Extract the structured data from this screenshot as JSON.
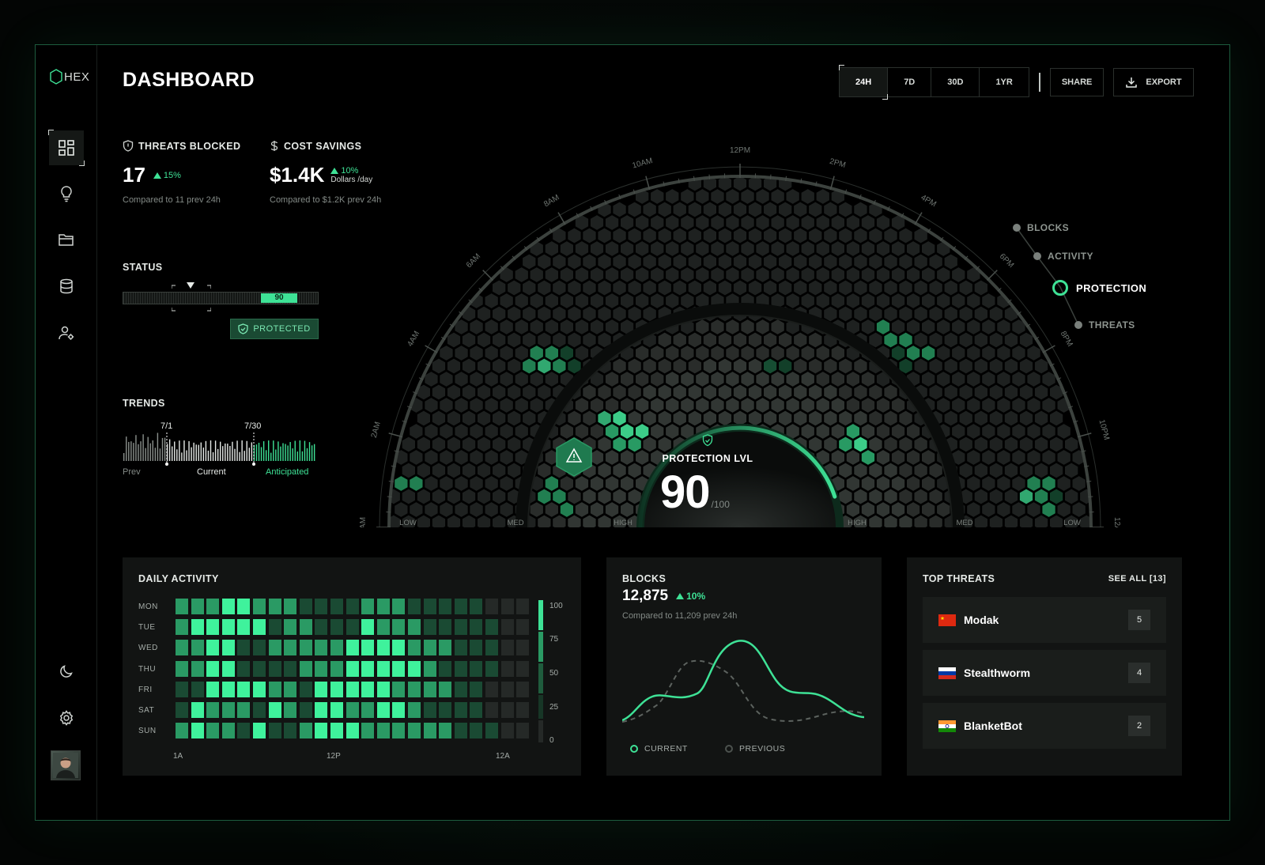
{
  "app": {
    "logo": "HEX"
  },
  "header": {
    "title": "DASHBOARD",
    "ranges": [
      "24H",
      "7D",
      "30D",
      "1YR"
    ],
    "active_range": "24H",
    "share_label": "SHARE",
    "export_label": "EXPORT"
  },
  "sidebar": {
    "items": [
      {
        "name": "dashboard",
        "icon": "grid-icon",
        "active": true
      },
      {
        "name": "insights",
        "icon": "lightbulb-icon"
      },
      {
        "name": "files",
        "icon": "folder-icon"
      },
      {
        "name": "database",
        "icon": "database-icon"
      },
      {
        "name": "users",
        "icon": "user-settings-icon"
      }
    ],
    "bottom": [
      {
        "name": "theme",
        "icon": "moon-icon"
      },
      {
        "name": "settings",
        "icon": "gear-icon"
      }
    ]
  },
  "kpis": {
    "threats_blocked": {
      "label": "THREATS BLOCKED",
      "value": "17",
      "delta": "15%",
      "sub": "Compared to 11 prev 24h"
    },
    "cost_savings": {
      "label": "COST SAVINGS",
      "value": "$1.4K",
      "delta": "10%",
      "unit": "Dollars /day",
      "sub": "Compared to $1.2K prev 24h"
    }
  },
  "status": {
    "label": "STATUS",
    "value": "90",
    "level": 0.9,
    "badge": "PROTECTED"
  },
  "trends": {
    "label": "TRENDS",
    "marker_start": "7/1",
    "marker_end": "7/30",
    "prev_label": "Prev",
    "current_label": "Current",
    "anticipated_label": "Anticipated"
  },
  "radial": {
    "time_labels": [
      "12AM",
      "2AM",
      "4AM",
      "6AM",
      "8AM",
      "10AM",
      "12PM",
      "2PM",
      "4PM",
      "6PM",
      "8PM",
      "10PM",
      "12AM"
    ],
    "zone_labels": [
      "LOW",
      "MED",
      "HIGH",
      "HIGH",
      "MED",
      "LOW"
    ],
    "center_label": "PROTECTION LVL",
    "center_value": "90",
    "center_max": "/100",
    "legend": [
      {
        "label": "BLOCKS",
        "active": false
      },
      {
        "label": "ACTIVITY",
        "active": false
      },
      {
        "label": "PROTECTION",
        "active": true
      },
      {
        "label": "THREATS",
        "active": false
      }
    ]
  },
  "daily_activity": {
    "title": "DAILY ACTIVITY",
    "days": [
      "MON",
      "TUE",
      "WED",
      "THU",
      "FRI",
      "SAT",
      "SUN"
    ],
    "x_labels": [
      "1A",
      "12P",
      "12A"
    ],
    "scale": [
      "100",
      "75",
      "50",
      "25",
      "0"
    ],
    "levels": [
      [
        2,
        2,
        2,
        3,
        3,
        2,
        2,
        2,
        1,
        1,
        1,
        1,
        2,
        2,
        2,
        1,
        1,
        1,
        1,
        1,
        0,
        0,
        0
      ],
      [
        2,
        3,
        3,
        3,
        3,
        3,
        1,
        2,
        2,
        1,
        1,
        1,
        3,
        2,
        2,
        2,
        1,
        1,
        1,
        1,
        1,
        0,
        0
      ],
      [
        2,
        2,
        3,
        3,
        1,
        1,
        2,
        2,
        2,
        2,
        2,
        3,
        3,
        3,
        3,
        2,
        2,
        2,
        1,
        1,
        1,
        0,
        0
      ],
      [
        2,
        2,
        3,
        3,
        1,
        1,
        1,
        1,
        2,
        2,
        2,
        3,
        3,
        3,
        3,
        3,
        2,
        1,
        1,
        1,
        1,
        0,
        0
      ],
      [
        1,
        1,
        3,
        3,
        3,
        3,
        2,
        2,
        1,
        3,
        3,
        3,
        3,
        3,
        2,
        2,
        2,
        2,
        1,
        1,
        0,
        0,
        0
      ],
      [
        1,
        3,
        2,
        2,
        2,
        1,
        3,
        2,
        1,
        3,
        3,
        2,
        2,
        3,
        3,
        2,
        1,
        1,
        1,
        1,
        0,
        0,
        0
      ],
      [
        2,
        3,
        2,
        2,
        1,
        3,
        1,
        1,
        2,
        3,
        3,
        3,
        2,
        2,
        2,
        2,
        2,
        2,
        1,
        1,
        1,
        0,
        0
      ]
    ]
  },
  "blocks": {
    "title": "BLOCKS",
    "value": "12,875",
    "delta": "10%",
    "sub": "Compared to 11,209 prev 24h",
    "legend_current": "CURRENT",
    "legend_previous": "PREVIOUS"
  },
  "top_threats": {
    "title": "TOP THREATS",
    "see_all": "SEE ALL [13]",
    "items": [
      {
        "name": "Modak",
        "count": "5",
        "flag": "china"
      },
      {
        "name": "Stealthworm",
        "count": "4",
        "flag": "russia"
      },
      {
        "name": "BlanketBot",
        "count": "2",
        "flag": "india"
      }
    ]
  },
  "colors": {
    "accent": "#3ee296",
    "accent_dark": "#1a4a33",
    "panel": "#121413"
  }
}
